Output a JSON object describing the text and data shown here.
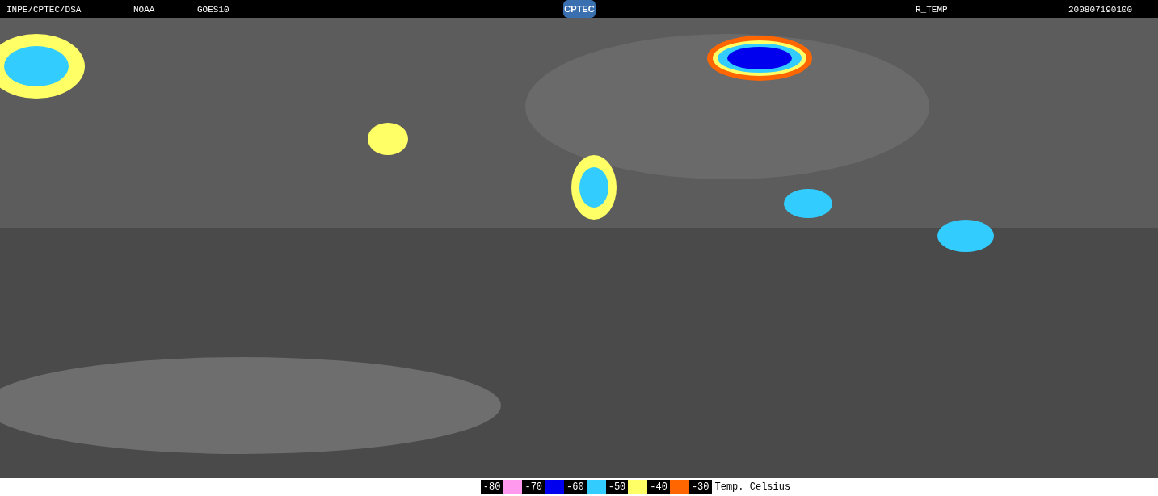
{
  "header": {
    "source": "INPE/CPTEC/DSA",
    "agency": "NOAA",
    "satellite": "GOES10",
    "logo": "CPTEC",
    "product": "R_TEMP",
    "timestamp": "200807190100"
  },
  "legend": {
    "items": [
      {
        "label": "-80",
        "color": "#ff99ee"
      },
      {
        "label": "-70",
        "color": "#0000ee"
      },
      {
        "label": "-60",
        "color": "#33ccff"
      },
      {
        "label": "-50",
        "color": "#ffff66"
      },
      {
        "label": "-40",
        "color": "#ff6600"
      },
      {
        "label": "-30"
      }
    ],
    "title": "Temp. Celsius"
  }
}
